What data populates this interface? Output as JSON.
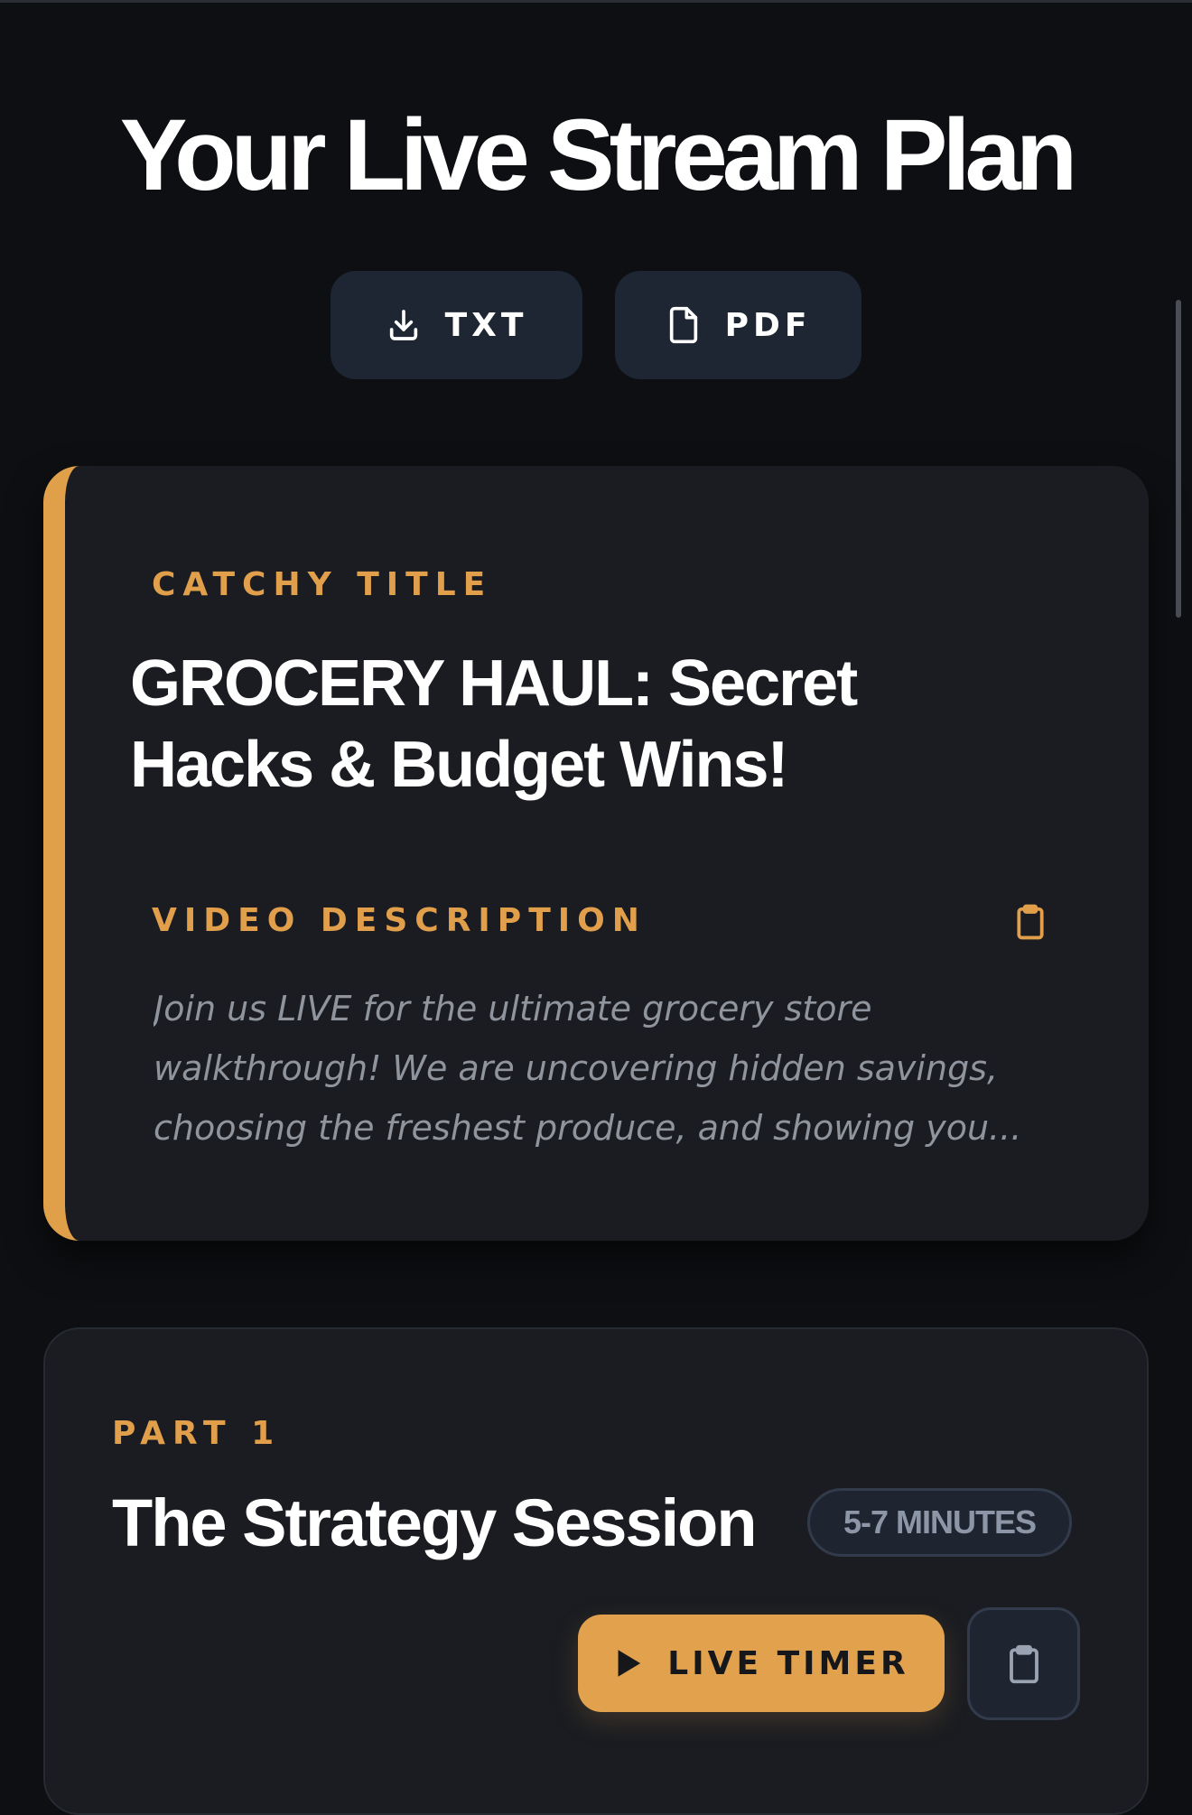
{
  "page": {
    "title": "Your Live Stream Plan"
  },
  "export": {
    "txt_label": "TXT",
    "pdf_label": "PDF"
  },
  "title_card": {
    "title_label": "CATCHY TITLE",
    "title": "GROCERY HAUL: Secret Hacks & Budget Wins!",
    "description_label": "VIDEO DESCRIPTION",
    "description_lines": [
      "Join us LIVE for the ultimate grocery store",
      "walkthrough! We are uncovering hidden savings,",
      "choosing the freshest produce, and showing you..."
    ]
  },
  "part": {
    "label": "PART 1",
    "title": "The Strategy Session",
    "duration": "5-7 MINUTES",
    "timer_label": "LIVE TIMER"
  },
  "icons": {
    "txt": "download-icon",
    "pdf": "file-icon",
    "description_copy": "clipboard-icon",
    "timer": "play-icon",
    "part_copy": "clipboard-icon"
  },
  "colors": {
    "background": "#0d0f12",
    "card": "#1a1c21",
    "accent": "#e0a04a",
    "button": "#1e2633",
    "muted_text": "#8f949d"
  }
}
